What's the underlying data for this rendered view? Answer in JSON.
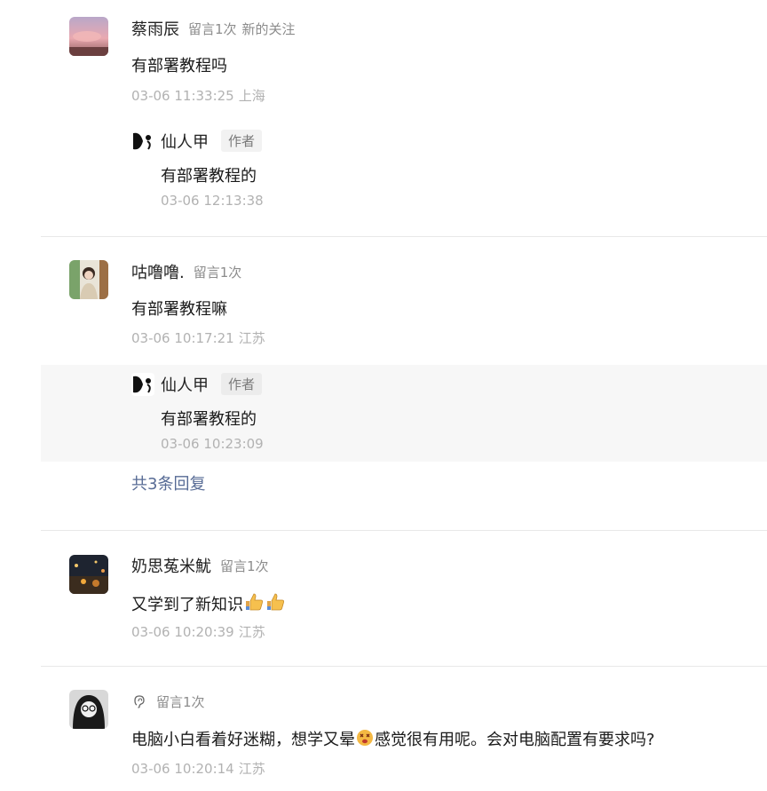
{
  "comments": [
    {
      "nickname": "蔡雨辰",
      "badge": "留言1次",
      "badge2": "新的关注",
      "text": "有部署教程吗",
      "time": "03-06 11:33:25",
      "location": "上海",
      "reply": {
        "name": "仙人甲",
        "tag": "作者",
        "text": "有部署教程的",
        "time": "03-06 12:13:38"
      }
    },
    {
      "nickname": "咕噜噜.",
      "badge": "留言1次",
      "text": "有部署教程嘛",
      "time": "03-06 10:17:21",
      "location": "江苏",
      "reply": {
        "name": "仙人甲",
        "tag": "作者",
        "text": "有部署教程的",
        "time": "03-06 10:23:09"
      },
      "more_replies": "共3条回复"
    },
    {
      "nickname": "奶思菟米魷",
      "badge": "留言1次",
      "text": "又学到了新知识",
      "emoji": [
        "thumbs-up",
        "thumbs-up"
      ],
      "time": "03-06 10:20:39",
      "location": "江苏"
    },
    {
      "nickname_icon": "ear-icon",
      "badge": "留言1次",
      "text_before": "电脑小白看着好迷糊，想学又晕",
      "text_after": "感觉很有用呢。会对电脑配置有要求吗?",
      "emoji": [
        "dizzy-face"
      ],
      "time": "03-06 10:20:14",
      "location": "江苏"
    }
  ]
}
